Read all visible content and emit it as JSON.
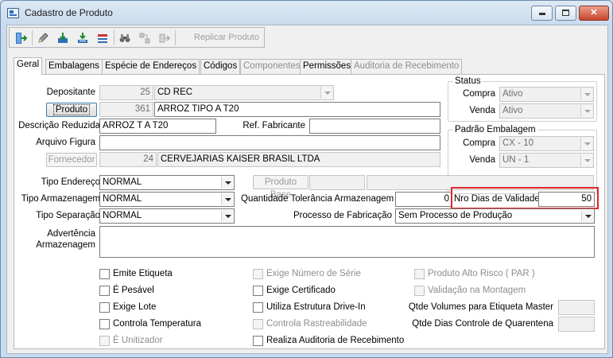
{
  "window": {
    "title": "Cadastro de Produto"
  },
  "toolbar": {
    "replicate_label": "Replicar Produto"
  },
  "tabs": [
    {
      "label": "Geral",
      "active": true,
      "disabled": false
    },
    {
      "label": "Embalagens",
      "active": false,
      "disabled": false
    },
    {
      "label": "Espécie de Endereços",
      "active": false,
      "disabled": false
    },
    {
      "label": "Códigos",
      "active": false,
      "disabled": false
    },
    {
      "label": "Componentes",
      "active": false,
      "disabled": true
    },
    {
      "label": "Permissões",
      "active": false,
      "disabled": false
    },
    {
      "label": "Auditoria de Recebimento",
      "active": false,
      "disabled": true
    }
  ],
  "form": {
    "depositante": {
      "label": "Depositante",
      "code": "25",
      "name": "CD REC"
    },
    "produto": {
      "button": "Produto",
      "code": "361",
      "name": "ARROZ TIPO A T20"
    },
    "descricao_reduzida": {
      "label": "Descrição Reduzida",
      "value": "ARROZ T A T20"
    },
    "ref_fabricante": {
      "label": "Ref. Fabricante",
      "value": ""
    },
    "arquivo_figura": {
      "label": "Arquivo Figura",
      "value": ""
    },
    "fornecedor": {
      "button": "Fornecedor",
      "code": "24",
      "name": "CERVEJARIAS KAISER BRASIL LTDA"
    },
    "tipo_endereco": {
      "label": "Tipo Endereço",
      "value": "NORMAL"
    },
    "tipo_armazenagem": {
      "label": "Tipo Armazenagem",
      "value": "NORMAL"
    },
    "tipo_separacao": {
      "label": "Tipo Separação",
      "value": "NORMAL"
    },
    "produto_base": {
      "button": "Produto Base",
      "value": ""
    },
    "quantidade_tolerancia": {
      "label": "Quantidade Tolerância Armazenagem",
      "value": "0"
    },
    "nro_dias_validade": {
      "label": "Nro Dias de Validade",
      "value": "50"
    },
    "processo_fabricacao": {
      "label": "Processo de Fabricação",
      "value": "Sem Processo de Produção"
    },
    "advertencia": {
      "label_line1": "Advertência",
      "label_line2": "Armazenagem",
      "value": ""
    },
    "qtde_volumes": {
      "label": "Qtde Volumes para Etiqueta Master",
      "value": ""
    },
    "qtde_dias_quarentena": {
      "label": "Qtde Dias Controle de Quarentena",
      "value": ""
    }
  },
  "status": {
    "title": "Status",
    "compra_label": "Compra",
    "compra_value": "Ativo",
    "venda_label": "Venda",
    "venda_value": "Ativo"
  },
  "padrao_embalagem": {
    "title": "Padrão Embalagem",
    "compra_label": "Compra",
    "compra_value": "CX - 10",
    "venda_label": "Venda",
    "venda_value": "UN - 1"
  },
  "checkboxes": {
    "emite_etiqueta": "Emite Etiqueta",
    "e_pesavel": "É Pesável",
    "exige_lote": "Exige Lote",
    "controla_temperatura": "Controla Temperatura",
    "e_unitizador": "É Unitizador",
    "exige_numero_serie": "Exige Número de Série",
    "exige_certificado": "Exige Certificado",
    "utiliza_estrutura_drive_in": "Utiliza Estrutura Drive-In",
    "controla_rastreabilidade": "Controla Rastreabilidade",
    "realiza_auditoria_recebimento": "Realiza Auditoria de Recebimento",
    "produto_alto_risco": "Produto Alto Risco ( PAR )",
    "validacao_montagem": "Validação na Montagem"
  }
}
